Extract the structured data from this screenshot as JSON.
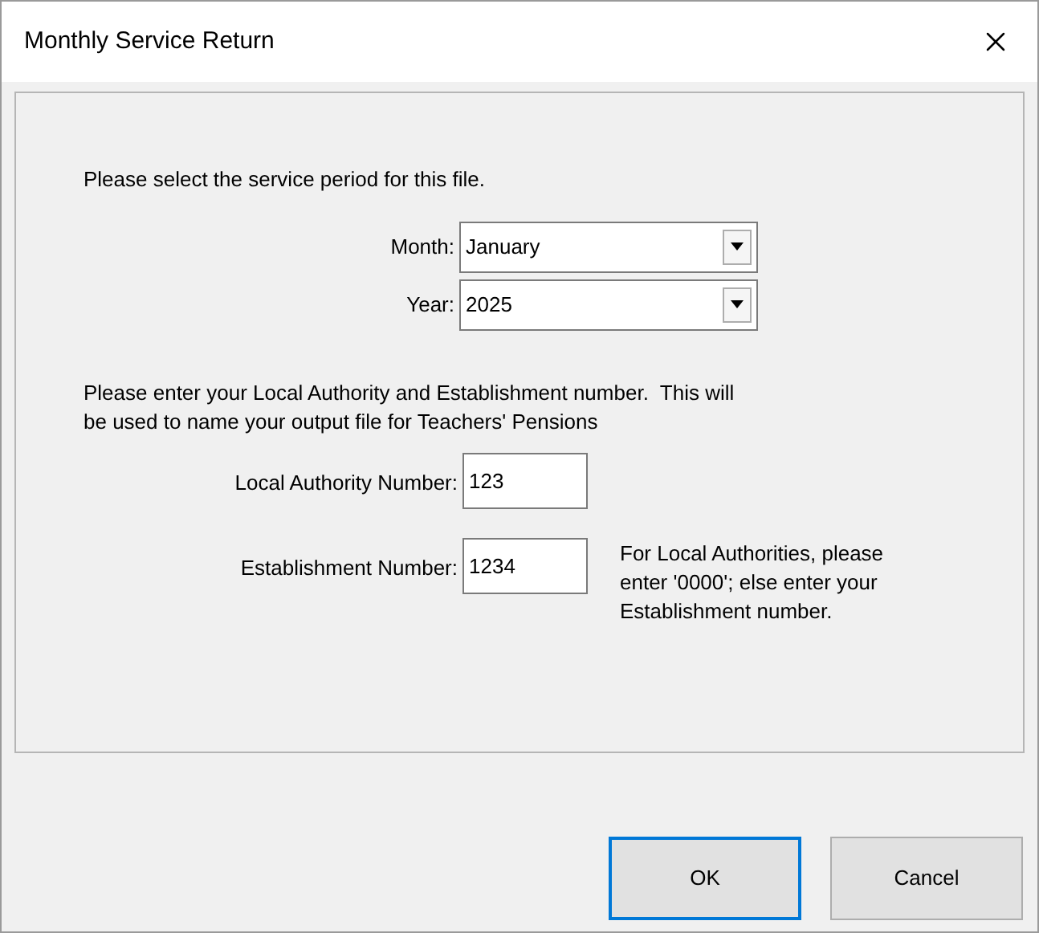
{
  "window": {
    "title": "Monthly Service Return"
  },
  "intro": "Please select the service period for this file.",
  "period_fields": [
    {
      "label": "Month:",
      "value": "January"
    },
    {
      "label": "Year:",
      "value": "2025"
    }
  ],
  "instructions": "Please enter your Local Authority and Establishment number.  This will be used to name your output file for Teachers' Pensions",
  "number_fields": [
    {
      "label": "Local Authority Number:",
      "value": "123"
    },
    {
      "label": "Establishment Number:",
      "value": "1234",
      "hint": "For Local Authorities, please enter '0000'; else enter your Establishment number."
    }
  ],
  "buttons": [
    {
      "label": "OK",
      "default": true
    },
    {
      "label": "Cancel",
      "default": false
    }
  ]
}
